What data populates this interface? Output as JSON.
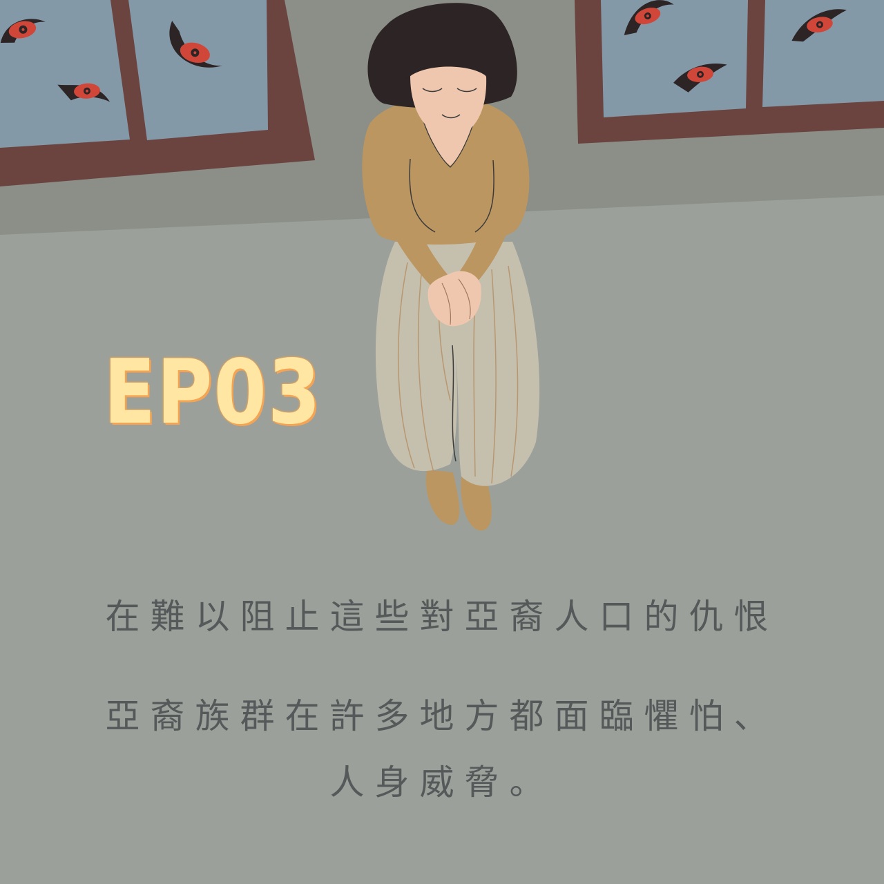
{
  "episode": "EP03",
  "captions": [
    "在難以阻止這些對亞裔人口的仇恨",
    "亞裔族群在許多地方都面臨懼怕、",
    "人身威脅。"
  ],
  "colors": {
    "floor": "#9ba09a",
    "wall": "#8b8f87",
    "window_frame": "#6b4440",
    "glass": "#8499a8",
    "eye_iris": "#d0473a",
    "sweater": "#bc9660",
    "pants": "#c5bfae",
    "hair": "#2c2425",
    "skin": "#efc7ae",
    "episode_fill": "#ffe6a3",
    "episode_glow": "#f6a64a",
    "caption": "#55595a"
  }
}
